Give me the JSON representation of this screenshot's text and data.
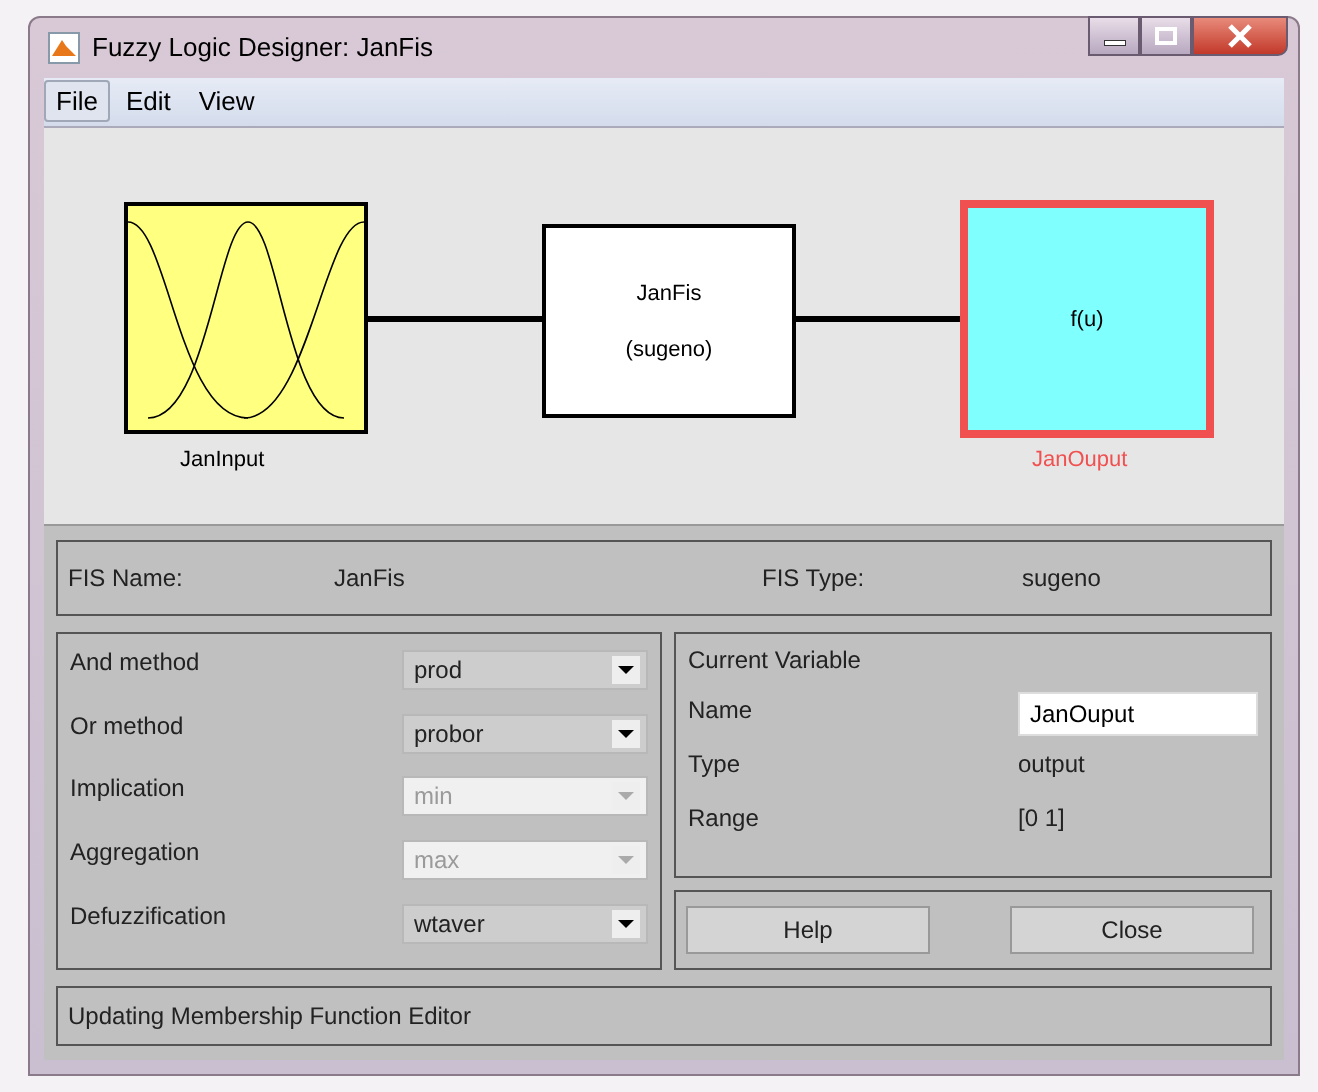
{
  "window": {
    "title": "Fuzzy Logic Designer: JanFis"
  },
  "menu": [
    {
      "label": "File",
      "selected": true
    },
    {
      "label": "Edit",
      "selected": false
    },
    {
      "label": "View",
      "selected": false
    }
  ],
  "diagram": {
    "inputs": [
      {
        "name": "JanInput",
        "selected": false
      }
    ],
    "system": {
      "name": "JanFis",
      "type": "(sugeno)"
    },
    "outputs": [
      {
        "name": "JanOuput",
        "symbol": "f(u)",
        "selected": true
      }
    ]
  },
  "fis": {
    "name_label": "FIS Name:",
    "name": "JanFis",
    "type_label": "FIS Type:",
    "type": "sugeno"
  },
  "methods": [
    {
      "label": "And method",
      "value": "prod",
      "disabled": false
    },
    {
      "label": "Or method",
      "value": "probor",
      "disabled": false
    },
    {
      "label": "Implication",
      "value": "min",
      "disabled": true
    },
    {
      "label": "Aggregation",
      "value": "max",
      "disabled": true
    },
    {
      "label": "Defuzzification",
      "value": "wtaver",
      "disabled": false
    }
  ],
  "current_variable": {
    "title": "Current Variable",
    "name_label": "Name",
    "name": "JanOuput",
    "type_label": "Type",
    "type": "output",
    "range_label": "Range",
    "range": "[0 1]"
  },
  "buttons": [
    "Help",
    "Close"
  ],
  "status": "Updating Membership Function Editor"
}
